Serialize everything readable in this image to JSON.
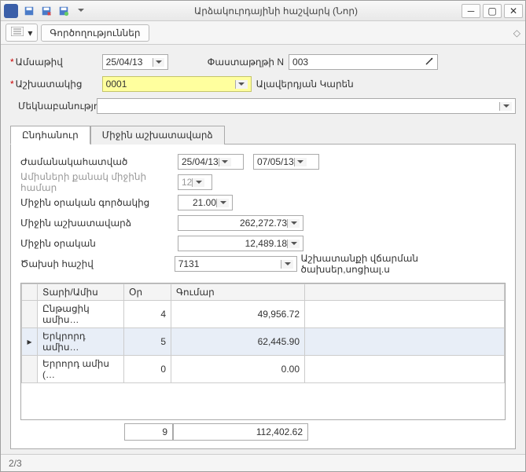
{
  "title": "Արձակուրդայինի հաշվարկ (Նոր)",
  "toolbar_tab": "Գործողություններ",
  "form": {
    "date_label": "Ամսաթիվ",
    "date_value": "25/04/13",
    "docnum_label": "Փաստաթղթի N",
    "docnum_value": "003",
    "employee_label": "Աշխատակից",
    "employee_code": "0001",
    "employee_name": "Ալավերդյան Կարեն",
    "comment_label": "Մեկնաբանություն",
    "comment_value": ""
  },
  "tabs": {
    "t1": "Ընդհանուր",
    "t2": "Միջին աշխատավարձ"
  },
  "section": {
    "period_label": "Ժամանակահատված",
    "period_from": "25/04/13",
    "period_to": "07/05/13",
    "avgmonths_label": "Ամիսների քանակ միջինի համար",
    "avgmonths": "12",
    "avgdayfactor_label": "Միջին օրական գործակից",
    "avgdayfactor": "21.00",
    "avgsalary_label": "Միջին աշխատավարձ",
    "avgsalary": "262,272.73",
    "avgdaily_label": "Միջին օրական",
    "avgdaily": "12,489.18",
    "expacc_label": "Ծախսի հաշիվ",
    "expacc_code": "7131",
    "expacc_name": "Աշխատանքի վճարման ծախսեր,սոցիալ.ս"
  },
  "grid": {
    "col1": "Տարի/Ամիս",
    "col2": "Օր",
    "col3": "Գումար",
    "rows": [
      {
        "name": "Ընթացիկ ամիս…",
        "days": "4",
        "amount": "49,956.72"
      },
      {
        "name": "Երկրորդ ամիս…",
        "days": "5",
        "amount": "62,445.90"
      },
      {
        "name": "Երրորդ ամիս (…",
        "days": "0",
        "amount": "0.00"
      }
    ],
    "tot_days": "9",
    "tot_amount": "112,402.62"
  },
  "status": "2/3"
}
